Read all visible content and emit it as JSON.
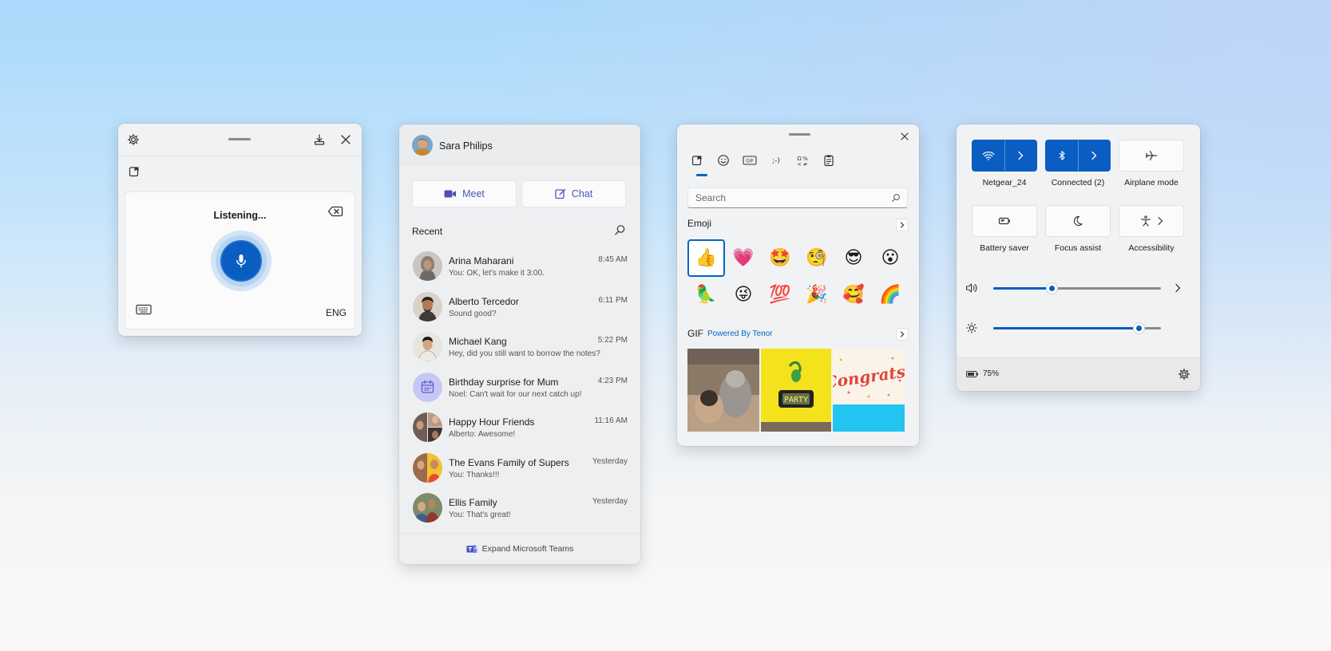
{
  "voice_typing": {
    "status": "Listening...",
    "language": "ENG",
    "icons": [
      "gear-icon",
      "dock-icon",
      "close-icon",
      "clipboard-icon",
      "backspace-icon",
      "microphone-icon",
      "keyboard-icon"
    ],
    "accent": "#0a5dc1"
  },
  "chat": {
    "user_name": "Sara Philips",
    "meet_label": "Meet",
    "chat_label": "Chat",
    "recent_label": "Recent",
    "conversations": [
      {
        "name": "Arina Maharani",
        "message": "You: OK, let's make it 3:00.",
        "time": "8:45 AM"
      },
      {
        "name": "Alberto Tercedor",
        "message": "Sound good?",
        "time": "6:11 PM"
      },
      {
        "name": "Michael Kang",
        "message": "Hey, did you still want to borrow the notes?",
        "time": "5:22 PM"
      },
      {
        "name": "Birthday surprise for Mum",
        "message": "Noel: Can't wait for our next catch up!",
        "time": "4:23 PM"
      },
      {
        "name": "Happy Hour Friends",
        "message": "Alberto: Awesome!",
        "time": "11:16 AM"
      },
      {
        "name": "The Evans Family of Supers",
        "message": "You: Thanks!!!",
        "time": "Yesterday"
      },
      {
        "name": "Ellis Family",
        "message": "You: That's great!",
        "time": "Yesterday"
      }
    ],
    "footer_label": "Expand Microsoft Teams",
    "accent": "#4f52b2"
  },
  "emoji_panel": {
    "search_placeholder": "Search",
    "emoji_label": "Emoji",
    "gif_label": "GIF",
    "powered_by": "Powered By Tenor",
    "tabs": [
      "recent-icon",
      "emoji-icon",
      "gif-icon",
      "kaomoji-icon",
      "symbols-icon",
      "clipboard-history-icon"
    ],
    "emojis": [
      "👍",
      "💗",
      "🤩",
      "🧐",
      "😎",
      "😮",
      "🦜",
      "😜",
      "💯",
      "🎉",
      "🥰",
      "🌈"
    ],
    "gif_party_text": "PARTY",
    "gif_congrats_text": "Congrats!",
    "accent": "#0067c0"
  },
  "quick_settings": {
    "tiles": [
      {
        "label": "Netgear_24",
        "icon": "wifi-icon",
        "on": true
      },
      {
        "label": "Connected (2)",
        "icon": "bluetooth-icon",
        "on": true
      },
      {
        "label": "Airplane mode",
        "icon": "airplane-icon",
        "on": false
      },
      {
        "label": "Battery saver",
        "icon": "battery-saver-icon",
        "on": false
      },
      {
        "label": "Focus assist",
        "icon": "moon-icon",
        "on": false
      },
      {
        "label": "Accessibility",
        "icon": "accessibility-icon",
        "on": false
      }
    ],
    "volume_percent": 35,
    "brightness_percent": 87,
    "battery": "75%",
    "accent": "#0a5dc1"
  }
}
